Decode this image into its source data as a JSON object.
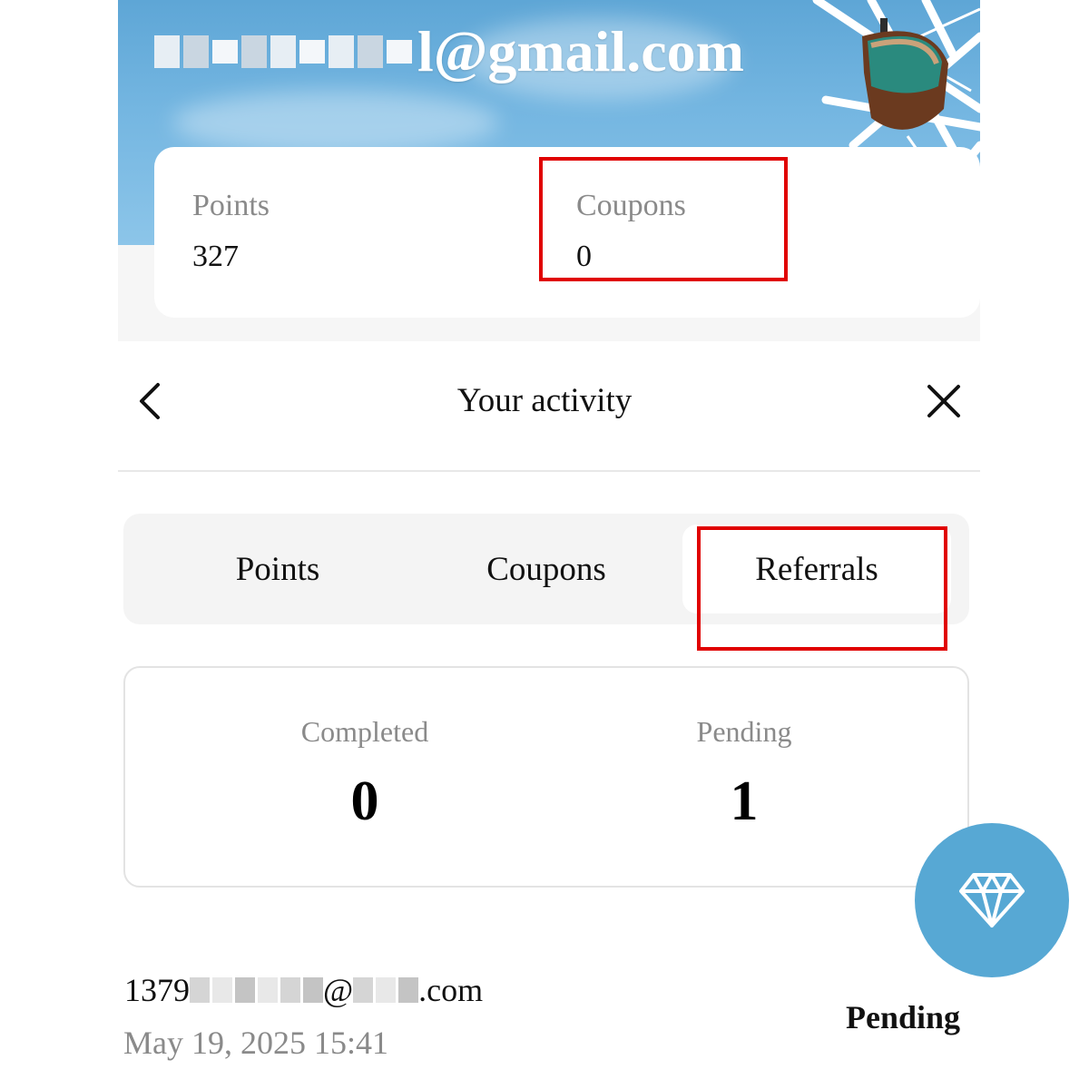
{
  "header": {
    "email_visible_suffix": "l@gmail.com"
  },
  "stats": {
    "points_label": "Points",
    "points_value": "327",
    "coupons_label": "Coupons",
    "coupons_value": "0"
  },
  "activity": {
    "title": "Your activity",
    "tabs": [
      {
        "label": "Points",
        "active": false
      },
      {
        "label": "Coupons",
        "active": false
      },
      {
        "label": "Referrals",
        "active": true
      }
    ],
    "summary": {
      "completed_label": "Completed",
      "completed_value": "0",
      "pending_label": "Pending",
      "pending_value": "1"
    },
    "referrals": [
      {
        "email_prefix": "1379",
        "email_mid": "@",
        "email_suffix": ".com",
        "date": "May 19, 2025 15:41",
        "status": "Pending"
      }
    ]
  },
  "icons": {
    "back": "chevron-left-icon",
    "close": "close-icon",
    "fab": "diamond-icon"
  },
  "colors": {
    "highlight": "#e00000",
    "fab": "#57a8d4",
    "sky": "#74b6e1"
  }
}
